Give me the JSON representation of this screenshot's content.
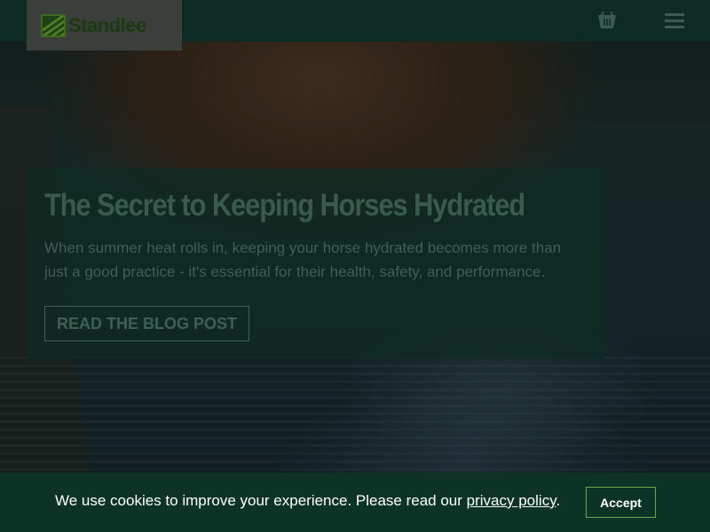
{
  "header": {
    "logo_text": "Standlee",
    "cart_icon": "basket-icon",
    "menu_icon": "hamburger-menu-icon"
  },
  "hero": {
    "title": "The Secret to Keeping Horses Hydrated",
    "description": "When summer heat rolls in, keeping your horse hydrated becomes more than just a good practice - it's essential for their health, safety, and performance.",
    "button_label": "READ THE BLOG POST"
  },
  "cookie_banner": {
    "text_before": "We use cookies to improve your experience. Please read our ",
    "link_label": "privacy policy",
    "text_after": ".",
    "accept_label": "Accept"
  },
  "colors": {
    "header_bg": "#0d2b24",
    "brand_green": "#3c6b1d",
    "cookie_bg": "#0d3327",
    "accept_border": "#6aa84f"
  }
}
